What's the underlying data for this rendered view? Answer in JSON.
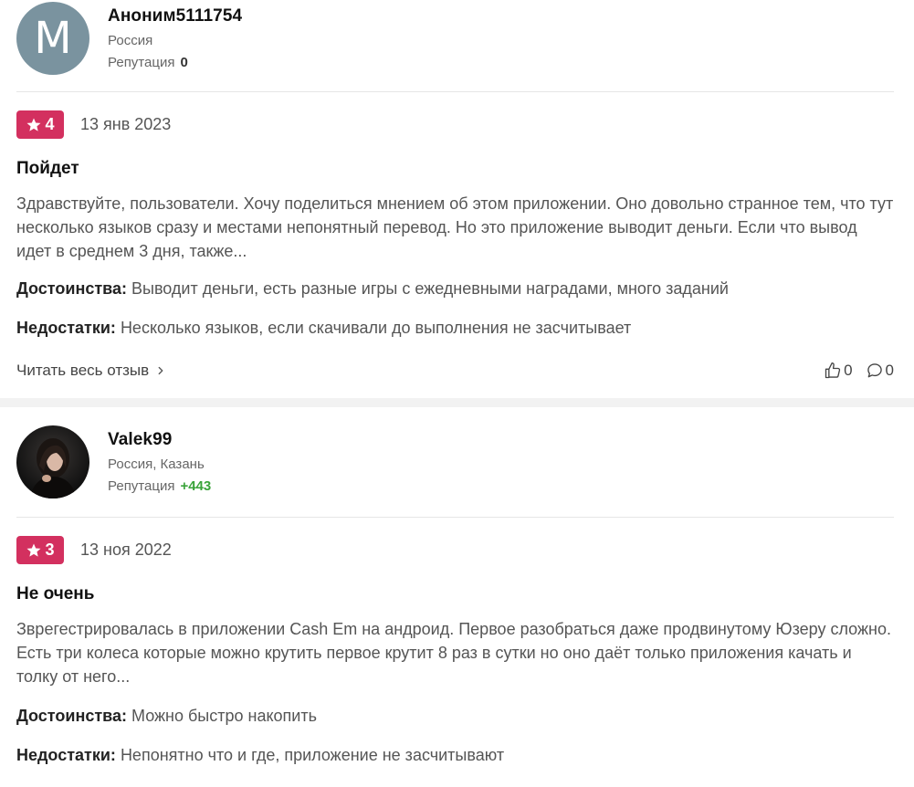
{
  "reviews": [
    {
      "user": {
        "avatar_letter": "M",
        "name": "Аноним5111754",
        "location": "Россия",
        "reputation_label": "Репутация",
        "reputation": "0"
      },
      "rating": "4",
      "date": "13 янв 2023",
      "title": "Пойдет",
      "text": "Здравствуйте, пользователи. Хочу поделиться мнением об этом приложении. Оно довольно странное тем, что тут несколько языков сразу и местами непонятный перевод. Но это приложение выводит деньги. Если что вывод идет в среднем 3 дня, также...",
      "pros_label": "Достоинства:",
      "pros": "Выводит деньги, есть разные игры с ежедневными наградами, много заданий",
      "cons_label": "Недостатки:",
      "cons": "Несколько языков, если скачивали до выполнения не засчитывает",
      "read_more": "Читать весь отзыв",
      "likes": "0",
      "comments": "0"
    },
    {
      "user": {
        "name": "Valek99",
        "location": "Россия, Казань",
        "reputation_label": "Репутация",
        "reputation": "+443"
      },
      "rating": "3",
      "date": "13 ноя 2022",
      "title": "Не очень",
      "text": "Зврегестрировалась в приложении Cash Em на андроид. Первое разобраться даже продвинутому Юзеру сложно. Есть три колеса которые можно крутить первое крутит 8 раз в сутки но оно даёт только приложения качать и толку от него...",
      "pros_label": "Достоинства:",
      "pros": "Можно быстро накопить",
      "cons_label": "Недостатки:",
      "cons": "Непонятно что и где, приложение не засчитывают"
    }
  ],
  "colors": {
    "badge": "#d3305f",
    "avatar_bg": "#7a939f",
    "positive": "#3aa33a"
  }
}
